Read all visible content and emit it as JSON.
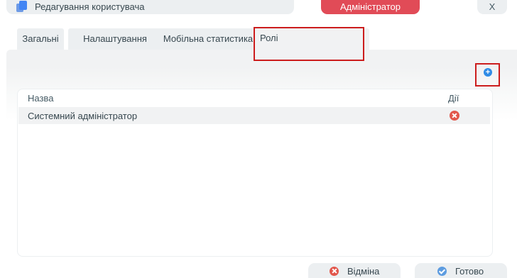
{
  "window": {
    "title": "Редагування користувача",
    "close_label": "X"
  },
  "user_role_badge": "Адміністратор",
  "tabs": [
    {
      "label": "Загальні"
    },
    {
      "label": "Налаштування"
    },
    {
      "label": "Мобільна статистика"
    },
    {
      "label": "Ролі",
      "active": true
    }
  ],
  "roles_table": {
    "columns": {
      "name": "Назва",
      "actions": "Дії"
    },
    "rows": [
      {
        "name": "Системний адміністратор"
      }
    ]
  },
  "footer": {
    "cancel_label": "Відміна",
    "done_label": "Готово"
  },
  "icons": {
    "window": "document-icon",
    "add": "plus-circle-icon",
    "delete": "close-circle-icon",
    "cancel": "close-circle-icon",
    "done": "check-circle-icon"
  },
  "colors": {
    "accent": "#e14b57",
    "add": "#2f8be6",
    "delete": "#e2574c",
    "done": "#5d9ce0",
    "highlight": "#cc1d1d"
  }
}
